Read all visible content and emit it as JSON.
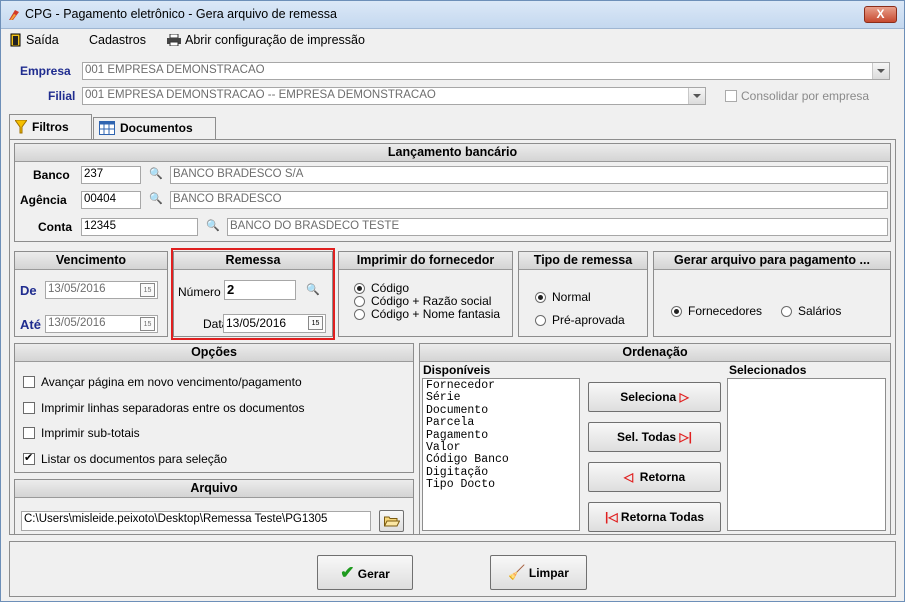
{
  "window": {
    "title": "CPG - Pagamento eletrônico - Gera arquivo de remessa",
    "close": "X"
  },
  "menu": {
    "saida": "Saída",
    "cadastros": "Cadastros",
    "config": "Abrir configuração de impressão"
  },
  "empresa": {
    "label": "Empresa",
    "value": "001 EMPRESA DEMONSTRACAO"
  },
  "filial": {
    "label": "Filial",
    "value": "001 EMPRESA DEMONSTRACAO -- EMPRESA DEMONSTRACAO",
    "consolidar": "Consolidar por empresa"
  },
  "tabs": {
    "filtros": "Filtros",
    "documentos": "Documentos"
  },
  "lancamento": {
    "title": "Lançamento bancário",
    "banco_label": "Banco",
    "banco_code": "237",
    "banco_name": "BANCO BRADESCO S/A",
    "agencia_label": "Agência",
    "agencia_code": "00404",
    "agencia_name": "BANCO BRADESCO",
    "conta_label": "Conta",
    "conta_code": "12345",
    "conta_name": "BANCO DO BRASDECO TESTE"
  },
  "vencimento": {
    "title": "Vencimento",
    "de_label": "De",
    "de": "13/05/2016",
    "ate_label": "Até",
    "ate": "13/05/2016"
  },
  "remessa": {
    "title": "Remessa",
    "numero_label": "Número",
    "numero": "2",
    "data_label": "Data",
    "data": "13/05/2016"
  },
  "imprimir": {
    "title": "Imprimir do fornecedor",
    "opt1": "Código",
    "opt2": "Código + Razão social",
    "opt3": "Código + Nome fantasia"
  },
  "tipo": {
    "title": "Tipo de remessa",
    "opt1": "Normal",
    "opt2": "Pré-aprovada"
  },
  "gerar_arquivo": {
    "title": "Gerar arquivo para pagamento ...",
    "opt1": "Fornecedores",
    "opt2": "Salários"
  },
  "opcoes": {
    "title": "Opções",
    "items": [
      {
        "label": "Avançar página em novo vencimento/pagamento",
        "checked": false
      },
      {
        "label": "Imprimir linhas separadoras entre os documentos",
        "checked": false
      },
      {
        "label": "Imprimir sub-totais",
        "checked": false
      },
      {
        "label": "Listar os documentos para seleção",
        "checked": true
      }
    ]
  },
  "arquivo": {
    "title": "Arquivo",
    "path": "C:\\Users\\misleide.peixoto\\Desktop\\Remessa Teste\\PG1305"
  },
  "ordenacao": {
    "title": "Ordenação",
    "disponiveis_label": "Disponíveis",
    "selecionados_label": "Selecionados",
    "disponiveis": [
      "Fornecedor",
      "Série",
      "Documento",
      "Parcela",
      "Pagamento",
      "Valor",
      "Código Banco",
      "Digitação",
      "Tipo Docto"
    ],
    "btn_seleciona": "Seleciona",
    "btn_sel_todas": "Sel. Todas",
    "btn_retorna": "Retorna",
    "btn_retorna_todas": "Retorna Todas"
  },
  "footer": {
    "gerar": "Gerar",
    "limpar": "Limpar"
  },
  "colors": {
    "accent_red": "#e02020",
    "label_blue": "#1f2c8f"
  }
}
